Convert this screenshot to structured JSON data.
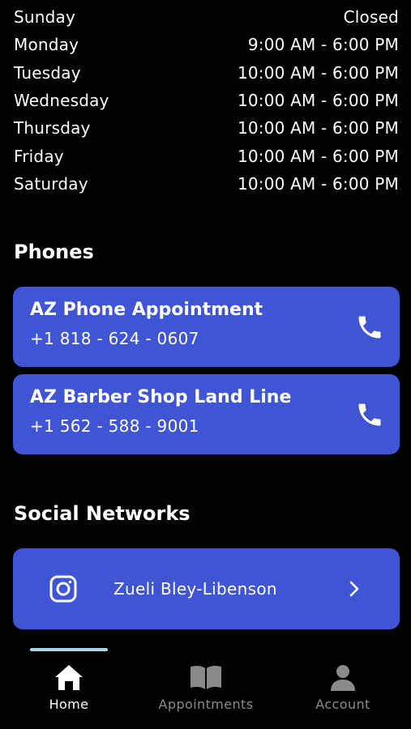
{
  "hours": [
    {
      "day": "Sunday",
      "time": "Closed"
    },
    {
      "day": "Monday",
      "time": "9:00 AM - 6:00 PM"
    },
    {
      "day": "Tuesday",
      "time": "10:00 AM - 6:00 PM"
    },
    {
      "day": "Wednesday",
      "time": "10:00 AM - 6:00 PM"
    },
    {
      "day": "Thursday",
      "time": "10:00 AM - 6:00 PM"
    },
    {
      "day": "Friday",
      "time": "10:00 AM - 6:00 PM"
    },
    {
      "day": "Saturday",
      "time": "10:00 AM - 6:00 PM"
    }
  ],
  "phones": {
    "title": "Phones",
    "items": [
      {
        "name": "AZ Phone Appointment",
        "number": "+1 818 - 624 - 0607",
        "icon": "phone-icon"
      },
      {
        "name": "AZ Barber Shop Land Line",
        "number": "+1 562 - 588 - 9001",
        "icon": "phone-icon"
      }
    ]
  },
  "social": {
    "title": "Social Networks",
    "items": [
      {
        "name": "Zueli Bley-Libenson",
        "icon": "instagram-icon",
        "chevron": "chevron-right-icon"
      }
    ]
  },
  "nav": {
    "items": [
      {
        "label": "Home",
        "icon": "home-icon",
        "active": true
      },
      {
        "label": "Appointments",
        "icon": "book-icon",
        "active": false
      },
      {
        "label": "Account",
        "icon": "person-icon",
        "active": false
      }
    ]
  },
  "colors": {
    "background": "#000000",
    "card": "#3f55d3",
    "indicator": "#a7d6ea",
    "inactive": "#8a8a8a"
  }
}
